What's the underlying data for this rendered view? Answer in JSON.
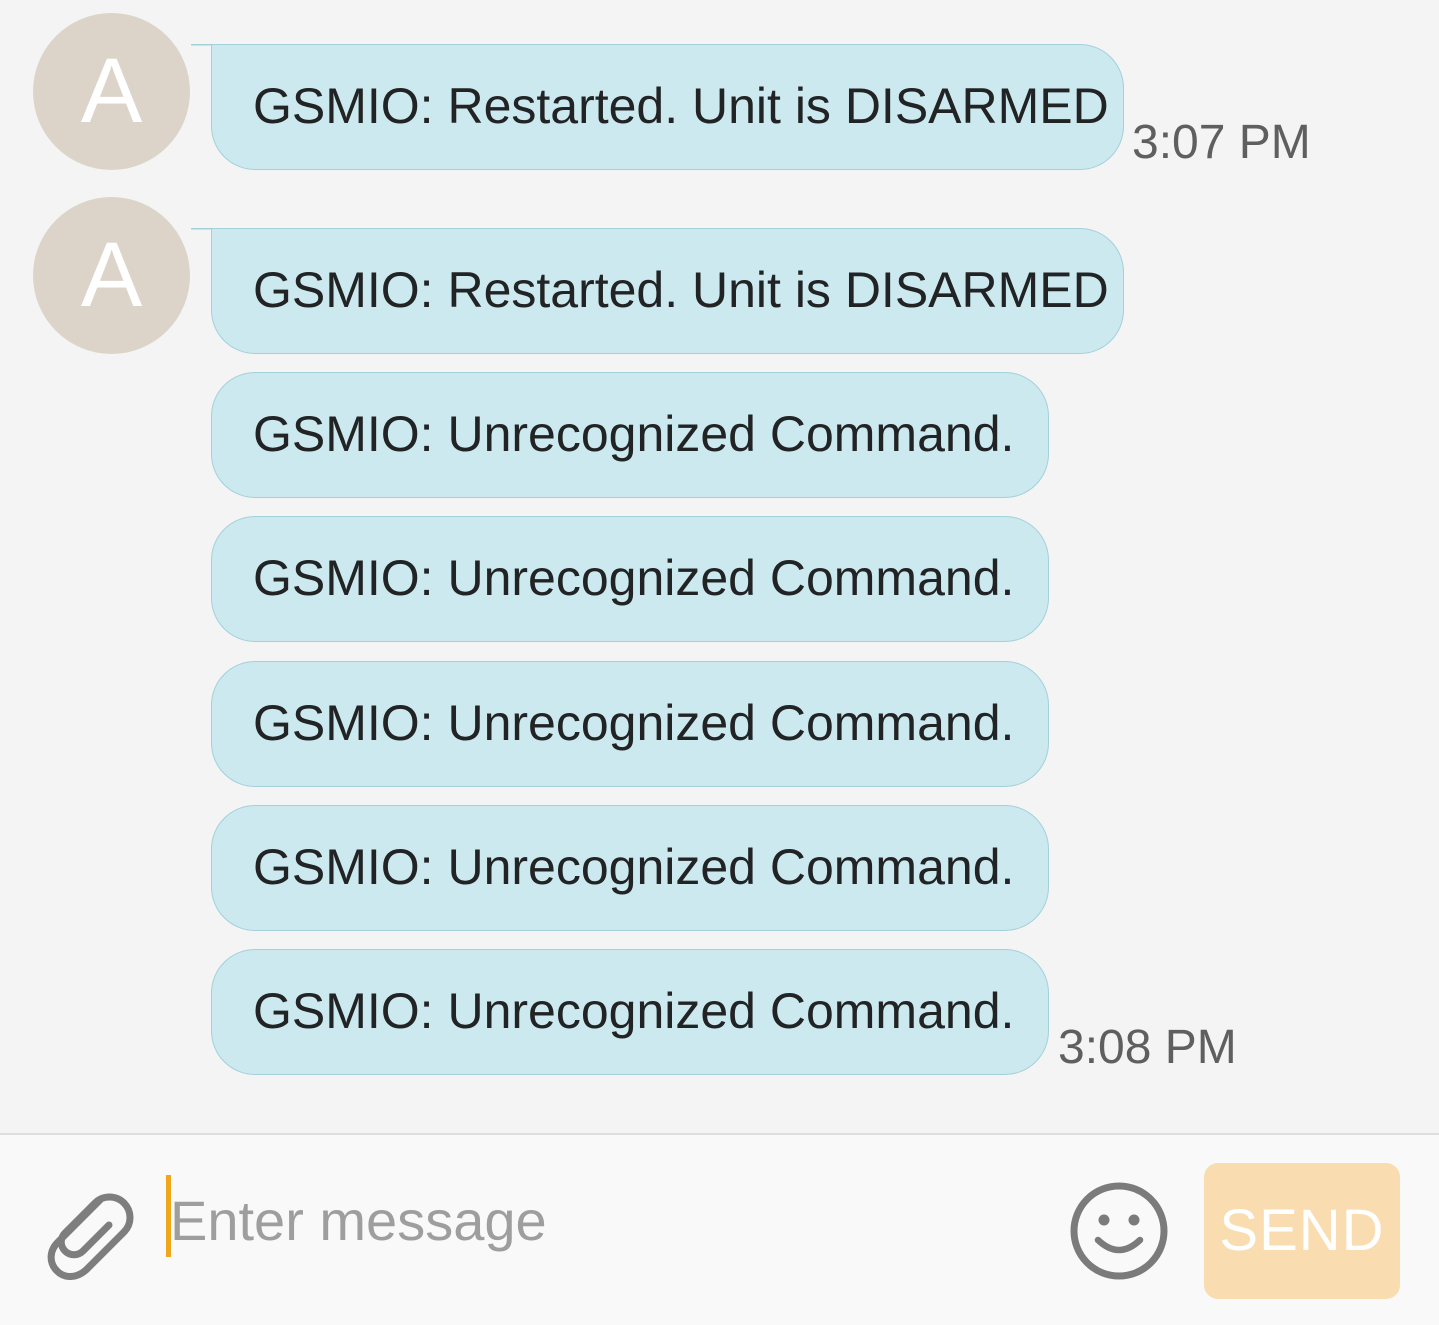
{
  "conversation": {
    "avatar_letter": "A",
    "groups": [
      {
        "messages": [
          "GSMIO: Restarted. Unit is DISARMED"
        ],
        "timestamp": "3:07 PM"
      },
      {
        "messages": [
          "GSMIO: Restarted. Unit is DISARMED",
          "GSMIO: Unrecognized Command.",
          "GSMIO: Unrecognized Command.",
          "GSMIO: Unrecognized Command.",
          "GSMIO: Unrecognized Command.",
          "GSMIO: Unrecognized Command."
        ],
        "timestamp": "3:08 PM"
      }
    ]
  },
  "composer": {
    "placeholder": "Enter message",
    "value": "",
    "attach_icon": "paperclip-icon",
    "emoji_icon": "smiley-icon",
    "send_label": "SEND"
  },
  "colors": {
    "incoming_bubble": "#cbe9ef",
    "avatar": "#ddd4c9",
    "send_button_disabled": "#f9ddb1",
    "cursor": "#f2a71a"
  }
}
